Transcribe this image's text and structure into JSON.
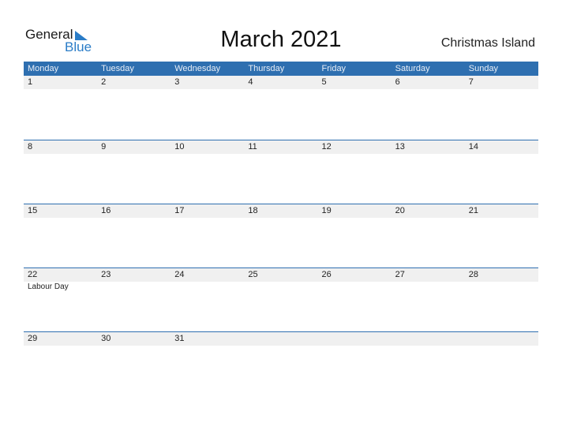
{
  "logo": {
    "general": "General",
    "blue": "Blue"
  },
  "title": "March 2021",
  "country": "Christmas Island",
  "colors": {
    "accent": "#2e6fb0",
    "logo_blue": "#2a7cc7",
    "row_bg": "#f0f0f0"
  },
  "weekdays": [
    "Monday",
    "Tuesday",
    "Wednesday",
    "Thursday",
    "Friday",
    "Saturday",
    "Sunday"
  ],
  "weeks": [
    {
      "days": [
        "1",
        "2",
        "3",
        "4",
        "5",
        "6",
        "7"
      ],
      "events": [
        "",
        "",
        "",
        "",
        "",
        "",
        ""
      ]
    },
    {
      "days": [
        "8",
        "9",
        "10",
        "11",
        "12",
        "13",
        "14"
      ],
      "events": [
        "",
        "",
        "",
        "",
        "",
        "",
        ""
      ]
    },
    {
      "days": [
        "15",
        "16",
        "17",
        "18",
        "19",
        "20",
        "21"
      ],
      "events": [
        "",
        "",
        "",
        "",
        "",
        "",
        ""
      ]
    },
    {
      "days": [
        "22",
        "23",
        "24",
        "25",
        "26",
        "27",
        "28"
      ],
      "events": [
        "Labour Day",
        "",
        "",
        "",
        "",
        "",
        ""
      ]
    },
    {
      "days": [
        "29",
        "30",
        "31",
        "",
        "",
        "",
        ""
      ],
      "events": [
        "",
        "",
        "",
        "",
        "",
        "",
        ""
      ]
    }
  ]
}
